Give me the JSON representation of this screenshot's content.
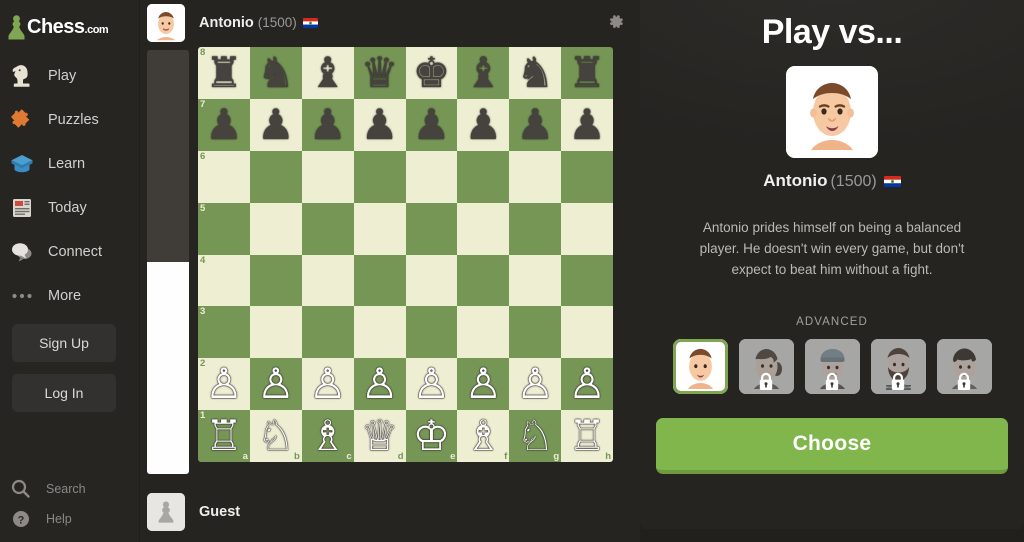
{
  "brand": {
    "name": "Chess",
    "tld": ".com",
    "logo_icon": "green-pawn-icon",
    "green": "#7fa650"
  },
  "sidebar": {
    "items": [
      {
        "label": "Play",
        "icon": "knight-piece-icon",
        "name": "play"
      },
      {
        "label": "Puzzles",
        "icon": "puzzle-piece-icon",
        "name": "puzzles"
      },
      {
        "label": "Learn",
        "icon": "graduation-cap-icon",
        "name": "learn"
      },
      {
        "label": "Today",
        "icon": "newspaper-icon",
        "name": "today"
      },
      {
        "label": "Connect",
        "icon": "speech-bubbles-icon",
        "name": "connect"
      },
      {
        "label": "More",
        "icon": "ellipsis-icon",
        "name": "more"
      }
    ],
    "auth": {
      "sign_up": "Sign Up",
      "log_in": "Log In"
    },
    "bottom": [
      {
        "label": "Search",
        "icon": "magnifier-icon",
        "name": "search"
      },
      {
        "label": "Help",
        "icon": "question-circle-icon",
        "name": "help"
      }
    ]
  },
  "top_player": {
    "name": "Antonio",
    "rating": "(1500)",
    "flag": "paraguay-flag",
    "avatar": "antonio-avatar"
  },
  "bottom_player": {
    "name": "Guest",
    "avatar": "guest-pawn-avatar"
  },
  "settings_icon": "gear-icon",
  "board": {
    "files": [
      "a",
      "b",
      "c",
      "d",
      "e",
      "f",
      "g",
      "h"
    ],
    "ranks": [
      "8",
      "7",
      "6",
      "5",
      "4",
      "3",
      "2",
      "1"
    ],
    "light_color": "#eeeed2",
    "dark_color": "#769656",
    "position": [
      [
        "br",
        "bn",
        "bb",
        "bq",
        "bk",
        "bb",
        "bn",
        "br"
      ],
      [
        "bp",
        "bp",
        "bp",
        "bp",
        "bp",
        "bp",
        "bp",
        "bp"
      ],
      [
        "",
        "",
        "",
        "",
        "",
        "",
        "",
        ""
      ],
      [
        "",
        "",
        "",
        "",
        "",
        "",
        "",
        ""
      ],
      [
        "",
        "",
        "",
        "",
        "",
        "",
        "",
        ""
      ],
      [
        "",
        "",
        "",
        "",
        "",
        "",
        "",
        ""
      ],
      [
        "wp",
        "wp",
        "wp",
        "wp",
        "wp",
        "wp",
        "wp",
        "wp"
      ],
      [
        "wr",
        "wn",
        "wb",
        "wq",
        "wk",
        "wb",
        "wn",
        "wr"
      ]
    ],
    "eval_bar": {
      "black_pct": 50,
      "white_pct": 50
    }
  },
  "panel": {
    "title": "Play vs...",
    "avatar": "antonio-avatar-large",
    "name": "Antonio",
    "rating": "(1500)",
    "flag": "paraguay-flag",
    "description": "Antonio prides himself on being a balanced player. He doesn't win every game, but don't expect to beat him without a fight.",
    "level_label": "ADVANCED",
    "bots": [
      {
        "name": "antonio",
        "selected": true,
        "locked": false
      },
      {
        "name": "bot-2",
        "selected": false,
        "locked": true
      },
      {
        "name": "bot-3",
        "selected": false,
        "locked": true
      },
      {
        "name": "bot-4",
        "selected": false,
        "locked": true
      },
      {
        "name": "bot-5",
        "selected": false,
        "locked": true
      }
    ],
    "choose_label": "Choose"
  }
}
